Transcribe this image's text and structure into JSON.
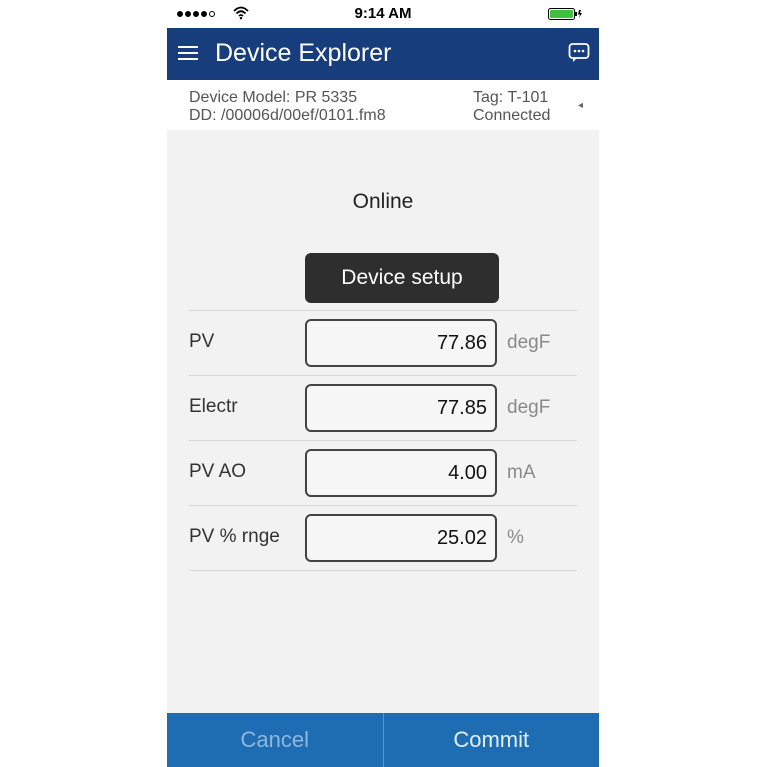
{
  "status_bar": {
    "time": "9:14 AM",
    "signal_bars_filled": 4,
    "signal_bars_total": 5
  },
  "header": {
    "title": "Device Explorer",
    "menu_icon": "hamburger-menu-icon",
    "action_icon": "chat-bubble-icon",
    "background_color": "#173d7c"
  },
  "device_info": {
    "model_label": "Device Model:",
    "model_value": "PR 5335",
    "dd_label": "DD:",
    "dd_value": "/00006d/00ef/0101.fm8",
    "tag_label": "Tag:",
    "tag_value": "T-101",
    "connection_status": "Connected"
  },
  "main": {
    "section_title": "Online",
    "setup_button_label": "Device setup",
    "rows": [
      {
        "label": "PV",
        "value": "77.86",
        "unit": "degF"
      },
      {
        "label": "Electr",
        "value": "77.85",
        "unit": "degF"
      },
      {
        "label": "PV AO",
        "value": "4.00",
        "unit": "mA"
      },
      {
        "label": "PV % rnge",
        "value": "25.02",
        "unit": "%"
      }
    ]
  },
  "footer": {
    "cancel_label": "Cancel",
    "commit_label": "Commit",
    "background_color": "#1e6db3"
  }
}
